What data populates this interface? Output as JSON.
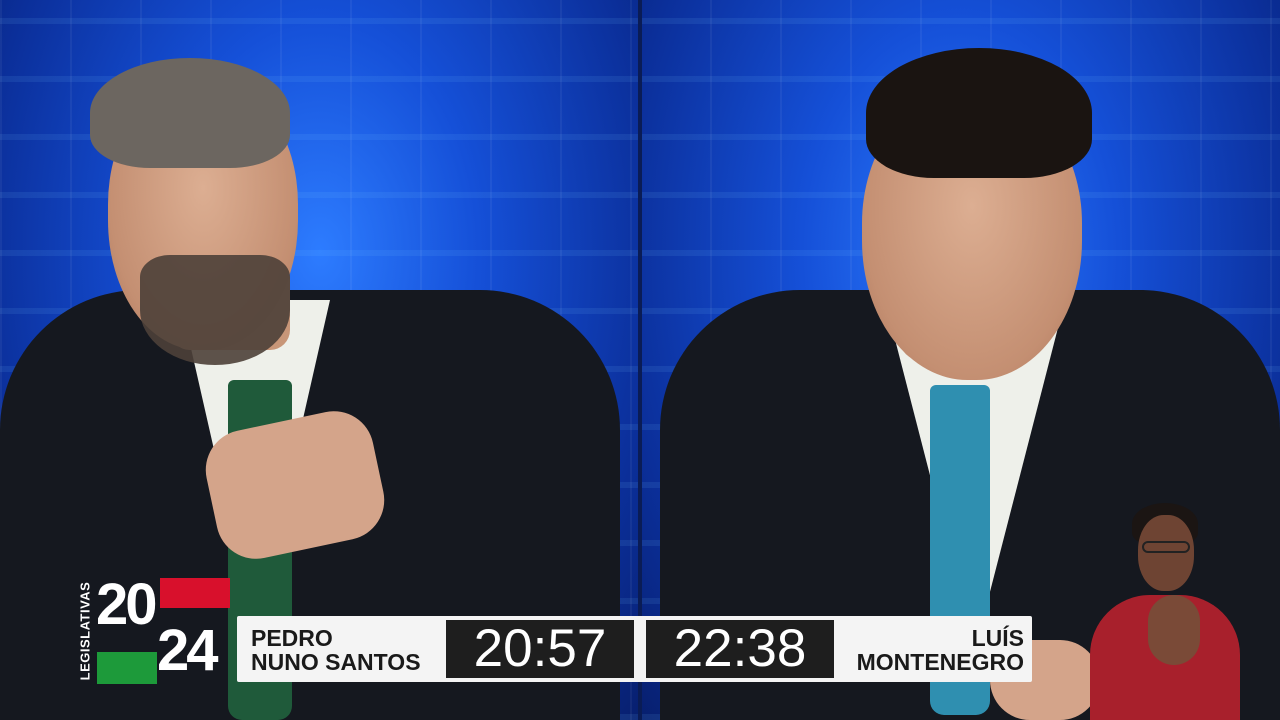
{
  "logo": {
    "vertical_text": "LEGISLATIVAS",
    "year_top": "20",
    "year_bottom": "24",
    "colors": {
      "red": "#d8102c",
      "green": "#1d9a3a"
    }
  },
  "timer_bar": {
    "left": {
      "name_line1": "PEDRO",
      "name_line2": "NUNO SANTOS",
      "time": "20:57"
    },
    "right": {
      "name_line1": "LUÍS",
      "name_line2": "MONTENEGRO",
      "time": "22:38"
    }
  },
  "colors": {
    "background_blue": "#1550d8",
    "bar_background": "#f4f4f4",
    "timer_background": "#1e1e1e",
    "left_tie": "#1f5a3a",
    "right_tie": "#2f8fb0"
  }
}
